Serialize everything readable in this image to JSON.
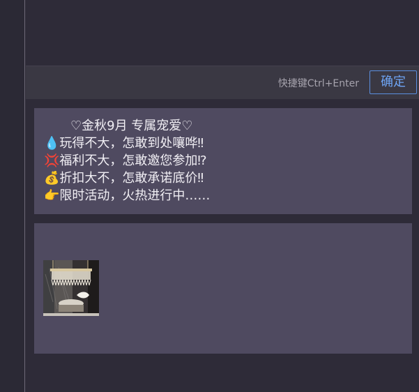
{
  "toolbar": {
    "shortcut_hint": "快捷键Ctrl+Enter",
    "confirm_label": "确定"
  },
  "message": {
    "lines": [
      "♡金秋9月 专属宠爱♡",
      "💧玩得不大，怎敢到处嚷哗‼",
      "💢福利不大，怎敢邀您参加⁉",
      "💰折扣大不，怎敢承诺底价‼",
      "👉限时活动，火热进行中……"
    ]
  },
  "media": {
    "thumbnail_icon": "chandelier-photo-thumbnail"
  },
  "colors": {
    "background": "#2e2b38",
    "card": "#4f4a60",
    "toolbar": "#3a3843",
    "accent": "#5b8fe0"
  }
}
